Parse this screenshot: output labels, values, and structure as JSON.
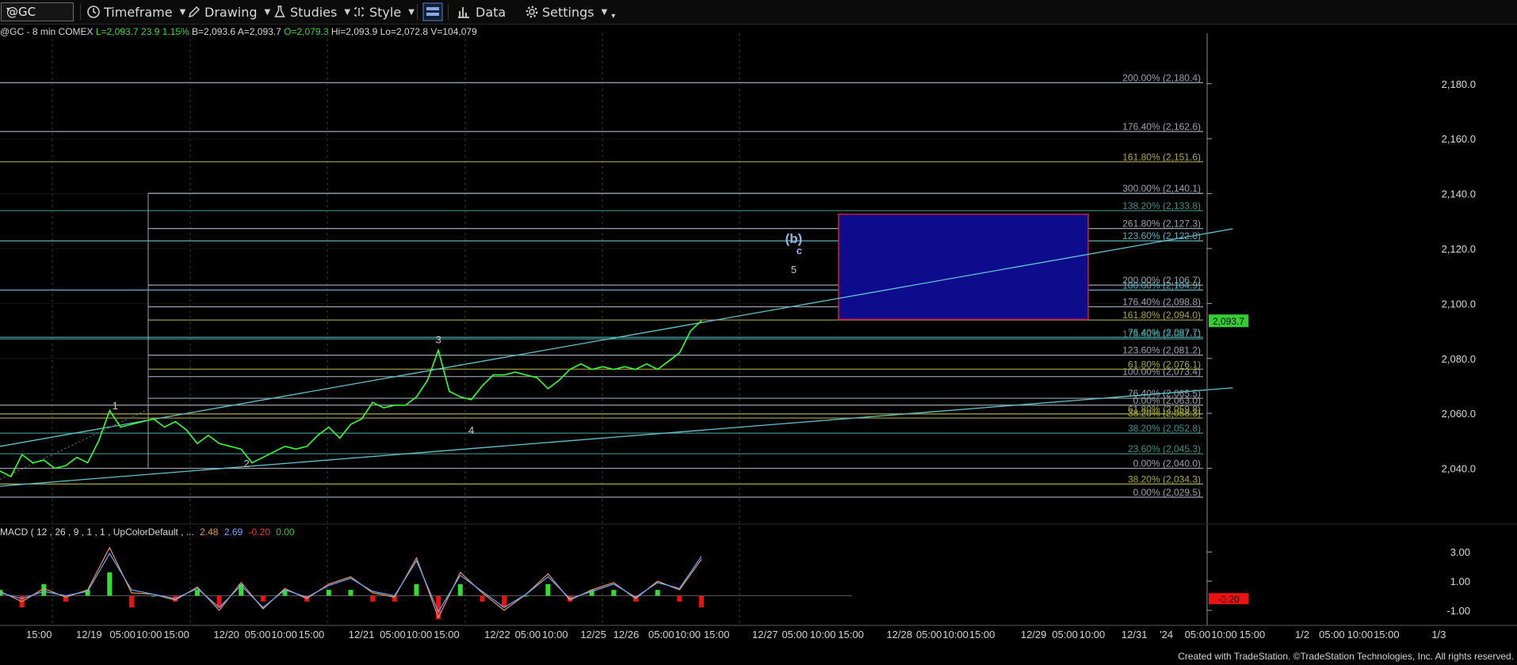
{
  "toolbar": {
    "symbol": "@GC",
    "items": [
      {
        "id": "timeframe",
        "icon": "clock-icon",
        "label": "Timeframe"
      },
      {
        "id": "drawing",
        "icon": "pencil-icon",
        "label": "Drawing"
      },
      {
        "id": "studies",
        "icon": "flask-icon",
        "label": "Studies"
      },
      {
        "id": "style",
        "icon": "style-icon",
        "label": "Style"
      },
      {
        "id": "layout",
        "icon": "layout-icon",
        "label": ""
      },
      {
        "id": "data",
        "icon": "bar-chart-icon",
        "label": "Data"
      },
      {
        "id": "settings",
        "icon": "gear-icon",
        "label": "Settings"
      }
    ]
  },
  "quote": {
    "prefix": "@GC - 8 min  COMEX",
    "last": "L=2,093.7",
    "change": "23.9",
    "change_pct": "1.15%",
    "bid": "B=2,093.6",
    "ask": "A=2,093.7",
    "open": "O=2,079.3",
    "high": "Hi=2,093.9",
    "low": "Lo=2,072.8",
    "volume": "V=104,079"
  },
  "macd_legend": {
    "label": "MACD ( 12 , 26 , 9 , 1 , 1 , UpColorDefault , ...",
    "macd": "2.48",
    "signal": "2.69",
    "hist": "-0.20",
    "zero": "0.00"
  },
  "colors": {
    "price": "#33ff33",
    "fib_white": "#9aa3ad",
    "fib_cyan": "#5bb0bd",
    "fib_olive": "#a9a840",
    "fib_teal": "#3f8f88",
    "trendline": "#63c3cf",
    "target_box_fill": "#0c0c8c",
    "target_box_border": "#cc1f3a",
    "macd_line": "#e69a55",
    "signal_line": "#6fa8ff",
    "hist_pos": "#33dd33",
    "hist_neg": "#ee1111",
    "last_price_tag": "#33cc33"
  },
  "footer": "Created with TradeStation. ©TradeStation Technologies, Inc. All rights reserved.",
  "chart_data": {
    "type": "line",
    "title": "@GC - 8 min COMEX",
    "x_tick_labels": [
      "15:00",
      "12/19",
      "05:00",
      "10:00",
      "15:00",
      "12/20",
      "05:00",
      "10:00",
      "15:00",
      "12/21",
      "05:00",
      "10:00",
      "15:00",
      "12/22",
      "05:00",
      "10:00",
      "12/25",
      "12/26",
      "05:00",
      "10:00",
      "15:00",
      "12/27",
      "05:00",
      "10:00",
      "15:00",
      "12/28",
      "05:00",
      "10:00",
      "15:00",
      "12/29",
      "05:00",
      "10:00",
      "12/31",
      "'24",
      "05:00",
      "10:00",
      "15:00",
      "1/2",
      "05:00",
      "10:00",
      "15:00",
      "1/3"
    ],
    "ylim": [
      2029.5,
      2188
    ],
    "y_ticks": [
      "2,040.0",
      "2,060.0",
      "2,080.0",
      "2,100.0",
      "2,120.0",
      "2,140.0",
      "2,160.0",
      "2,180.0"
    ],
    "y_tick_values": [
      2040,
      2060,
      2080,
      2100,
      2120,
      2140,
      2160,
      2180
    ],
    "last_price": "2,093.7",
    "series": [
      {
        "name": "@GC",
        "x_index": [
          0,
          2,
          4,
          6,
          8,
          10,
          12,
          14,
          16,
          18,
          20,
          22,
          24,
          26,
          28,
          30,
          32,
          34,
          36,
          38,
          40,
          42,
          44,
          46,
          48,
          50,
          52,
          54,
          56,
          58,
          60,
          62,
          64,
          66,
          68,
          70,
          72,
          74,
          76,
          78,
          80,
          82,
          84,
          86,
          88,
          90,
          92,
          94,
          96,
          98,
          100,
          102,
          104,
          106,
          108,
          110,
          112,
          114,
          116,
          118,
          120,
          122,
          124,
          126,
          128
        ],
        "values": [
          2039,
          2037,
          2045,
          2042,
          2043,
          2040,
          2041,
          2044,
          2042,
          2050,
          2061,
          2055,
          2056,
          2057,
          2058,
          2055,
          2057,
          2054,
          2049,
          2052,
          2049,
          2048,
          2047,
          2042,
          2044,
          2046,
          2048,
          2047,
          2048,
          2052,
          2055,
          2051,
          2056,
          2058,
          2064,
          2062,
          2063,
          2063,
          2066,
          2072,
          2083,
          2068,
          2066,
          2065,
          2070,
          2074,
          2074,
          2075,
          2074,
          2073,
          2069,
          2072,
          2076,
          2078,
          2076,
          2077,
          2076,
          2077,
          2076,
          2078,
          2076,
          2079,
          2082,
          2090,
          2093.7
        ]
      }
    ],
    "wave_labels": [
      {
        "text": "1",
        "x_index": 21,
        "value": 2061.5
      },
      {
        "text": "2",
        "x_index": 45,
        "value": 2040.5
      },
      {
        "text": "3",
        "x_index": 80,
        "value": 2085.5
      },
      {
        "text": "4",
        "x_index": 86,
        "value": 2052.5
      },
      {
        "text": "(b)",
        "x_index": 134,
        "value": 2122
      },
      {
        "text": "c",
        "x_index": 135,
        "value": 2118
      },
      {
        "text": "5",
        "x_index": 134,
        "value": 2111
      }
    ],
    "target_box": {
      "y_top": 2132.5,
      "y_bottom": 2094.2,
      "x_start_index": 120,
      "x_end_index": 156
    },
    "fib_levels": [
      {
        "label": "200.00% (2,180.4)",
        "value": 2180.4,
        "group": "white",
        "start": "left"
      },
      {
        "label": "176.40% (2,162.6)",
        "value": 2162.6,
        "group": "white",
        "start": "left"
      },
      {
        "label": "161.80% (2,151.6)",
        "value": 2151.6,
        "group": "olive",
        "start": "left"
      },
      {
        "label": "300.00% (2,140.1)",
        "value": 2140.1,
        "group": "white",
        "start": "wave1"
      },
      {
        "label": "138.20% (2,133.8)",
        "value": 2133.8,
        "group": "teal",
        "start": "left"
      },
      {
        "label": "261.80% (2,127.3)",
        "value": 2127.3,
        "group": "white",
        "start": "wave1"
      },
      {
        "label": "123.60% (2,122.8)",
        "value": 2122.8,
        "group": "cyan",
        "start": "left"
      },
      {
        "label": "200.00% (2,106.7)",
        "value": 2106.7,
        "group": "white",
        "start": "wave1"
      },
      {
        "label": "100.00% (2,104.9)",
        "value": 2104.9,
        "group": "cyan",
        "start": "left"
      },
      {
        "label": "176.40% (2,098.8)",
        "value": 2098.8,
        "group": "white",
        "start": "wave1"
      },
      {
        "label": "161.80% (2,094.0)",
        "value": 2094.0,
        "group": "olive",
        "start": "wave1"
      },
      {
        "label": "76.40% (2,087.7)",
        "value": 2087.7,
        "group": "cyan",
        "start": "left"
      },
      {
        "label": "176.40% (2,087.1)",
        "value": 2087.1,
        "group": "teal",
        "start": "left"
      },
      {
        "label": "123.60% (2,081.2)",
        "value": 2081.2,
        "group": "white",
        "start": "wave1"
      },
      {
        "label": "61.80% (2,076.1)",
        "value": 2076.1,
        "group": "olive",
        "start": "wave1"
      },
      {
        "label": "100.00% (2,073.4)",
        "value": 2073.4,
        "group": "white",
        "start": "wave1"
      },
      {
        "label": "76.40% (2,065.5)",
        "value": 2065.5,
        "group": "white",
        "start": "wave1"
      },
      {
        "label": "0.00% (2,063.0)",
        "value": 2063.0,
        "group": "white",
        "start": "left"
      },
      {
        "label": "61.80% (2,059.8)",
        "value": 2059.8,
        "group": "olive",
        "start": "left"
      },
      {
        "label": "38.20% (2,058.3)",
        "value": 2058.3,
        "group": "olive",
        "start": "left"
      },
      {
        "label": "38.20% (2,052.8)",
        "value": 2052.8,
        "group": "teal",
        "start": "left"
      },
      {
        "label": "23.60% (2,045.3)",
        "value": 2045.3,
        "group": "teal",
        "start": "left"
      },
      {
        "label": "0.00% (2,040.0)",
        "value": 2040.0,
        "group": "white",
        "start": "left"
      },
      {
        "label": "38.20% (2,034.3)",
        "value": 2034.3,
        "group": "olive",
        "start": "left"
      },
      {
        "label": "0.00% (2,029.5)",
        "value": 2029.5,
        "group": "white",
        "start": "left"
      }
    ],
    "trendlines": [
      {
        "from": [
          0,
          2048
        ],
        "to": [
          185,
          2127.2
        ]
      },
      {
        "from": [
          0,
          2033.5
        ],
        "to": [
          185,
          2069.3
        ]
      }
    ],
    "macd": {
      "ylim": [
        -1.6,
        3.5
      ],
      "y_ticks": [
        "3.00",
        "1.00",
        "-1.00"
      ],
      "y_tick_values": [
        3,
        1,
        -1
      ],
      "last_value": "-0.20",
      "x_index": [
        0,
        4,
        8,
        12,
        16,
        20,
        24,
        28,
        32,
        36,
        40,
        44,
        48,
        52,
        56,
        60,
        64,
        68,
        72,
        76,
        80,
        84,
        88,
        92,
        96,
        100,
        104,
        108,
        112,
        116,
        120,
        124,
        128
      ],
      "macd": [
        0.3,
        -0.4,
        0.5,
        -0.1,
        0.4,
        3.3,
        0.2,
        0.1,
        -0.3,
        0.6,
        -1.0,
        0.9,
        -0.9,
        0.5,
        -0.2,
        0.8,
        1.3,
        0.2,
        -0.1,
        2.6,
        -1.5,
        1.6,
        0.2,
        -1.0,
        0.1,
        1.5,
        -0.3,
        0.4,
        0.9,
        -0.2,
        1.0,
        0.4,
        2.5
      ],
      "signal": [
        0.2,
        -0.2,
        0.3,
        0.0,
        0.3,
        2.9,
        0.4,
        0.1,
        -0.2,
        0.5,
        -0.8,
        0.7,
        -0.8,
        0.4,
        -0.1,
        0.7,
        1.2,
        0.3,
        0.0,
        2.4,
        -1.1,
        1.4,
        0.3,
        -0.8,
        0.1,
        1.3,
        -0.2,
        0.3,
        0.8,
        -0.1,
        0.9,
        0.5,
        2.7
      ],
      "hist": [
        0.1,
        -0.2,
        0.2,
        -0.1,
        0.1,
        0.4,
        -0.2,
        0.0,
        -0.1,
        0.1,
        -0.2,
        0.2,
        -0.1,
        0.1,
        -0.1,
        0.1,
        0.1,
        -0.1,
        -0.1,
        0.2,
        -0.4,
        0.2,
        -0.1,
        -0.2,
        0.0,
        0.2,
        -0.1,
        0.1,
        0.1,
        -0.1,
        0.1,
        -0.1,
        -0.2
      ]
    }
  }
}
